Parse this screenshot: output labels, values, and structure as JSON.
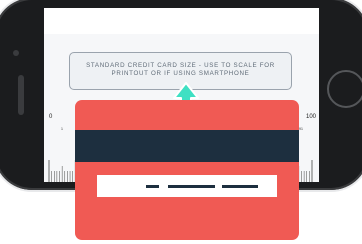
{
  "notice": {
    "line1": "STANDARD CREDIT CARD SIZE - USE TO SCALE FOR",
    "line2": "PRINTOUT OR IF USING SMARTPHONE"
  },
  "ruler": {
    "start_label": "0",
    "end_label": "100",
    "minor_labels": [
      "1",
      "91"
    ]
  },
  "colors": {
    "card": "#f05a54",
    "stripe": "#1d2f3f",
    "arrow": "#3ee0c3",
    "phone": "#1b1c1e"
  },
  "icons": {
    "arrow": "arrow-up-icon"
  }
}
